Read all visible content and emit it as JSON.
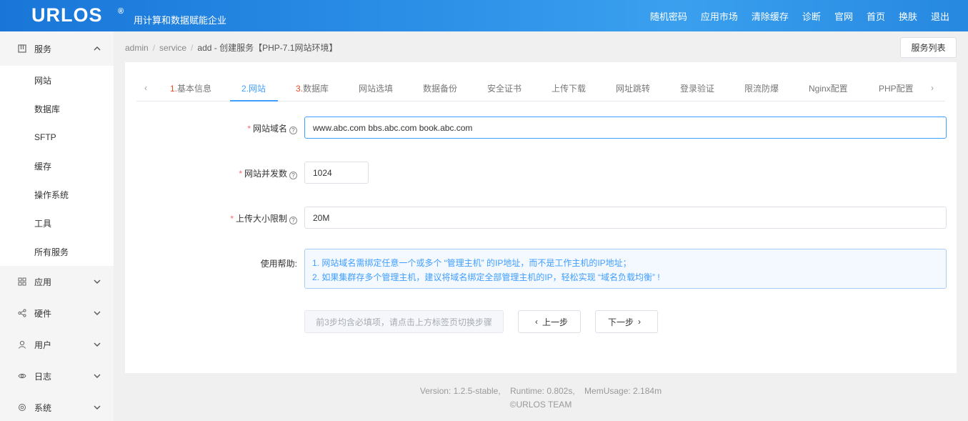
{
  "header": {
    "logo": "URLOS",
    "logo_mark": "®",
    "slogan": "用计算和数据赋能企业",
    "nav": [
      "随机密码",
      "应用市场",
      "清除缓存",
      "诊断",
      "官网",
      "首页",
      "换肤",
      "退出"
    ]
  },
  "sidebar": {
    "service": {
      "label": "服务",
      "items": [
        "网站",
        "数据库",
        "SFTP",
        "缓存",
        "操作系统",
        "工具",
        "所有服务"
      ]
    },
    "groups": [
      "应用",
      "硬件",
      "用户",
      "日志",
      "系统"
    ]
  },
  "breadcrumb": {
    "parts": [
      "admin",
      "service",
      "add"
    ],
    "current": "创建服务【PHP-7.1网站环境】"
  },
  "service_list_button": "服务列表",
  "tabs": [
    {
      "num": "1.",
      "label": "基本信息"
    },
    {
      "num": "2.",
      "label": "网站"
    },
    {
      "num": "3.",
      "label": "数据库"
    },
    {
      "num": "",
      "label": "网站选填"
    },
    {
      "num": "",
      "label": "数据备份"
    },
    {
      "num": "",
      "label": "安全证书"
    },
    {
      "num": "",
      "label": "上传下载"
    },
    {
      "num": "",
      "label": "网址跳转"
    },
    {
      "num": "",
      "label": "登录验证"
    },
    {
      "num": "",
      "label": "限流防爆"
    },
    {
      "num": "",
      "label": "Nginx配置"
    },
    {
      "num": "",
      "label": "PHP配置"
    }
  ],
  "form": {
    "domain": {
      "label": "网站域名",
      "value": "www.abc.com bbs.abc.com book.abc.com"
    },
    "concurrency": {
      "label": "网站并发数",
      "value": "1024"
    },
    "upload": {
      "label": "上传大小限制",
      "value": "20M"
    },
    "help": {
      "label": "使用帮助:",
      "line1": "1. 网站域名需绑定任意一个或多个 “管理主机” 的IP地址，而不是工作主机的IP地址；",
      "line2": "2. 如果集群存多个管理主机，建议将域名绑定全部管理主机的IP，轻松实现 “域名负载均衡” !"
    }
  },
  "buttons": {
    "hint": "前3步均含必填项，请点击上方标签页切换步骤",
    "prev": "上一步",
    "next": "下一步"
  },
  "footer": {
    "version": "Version: 1.2.5-stable,    Runtime: 0.802s,    MemUsage: 2.184m",
    "copyright": "©URLOS TEAM"
  },
  "colors": {
    "header": "#2a8de6",
    "accent": "#409eff",
    "required": "#f56c6c"
  }
}
